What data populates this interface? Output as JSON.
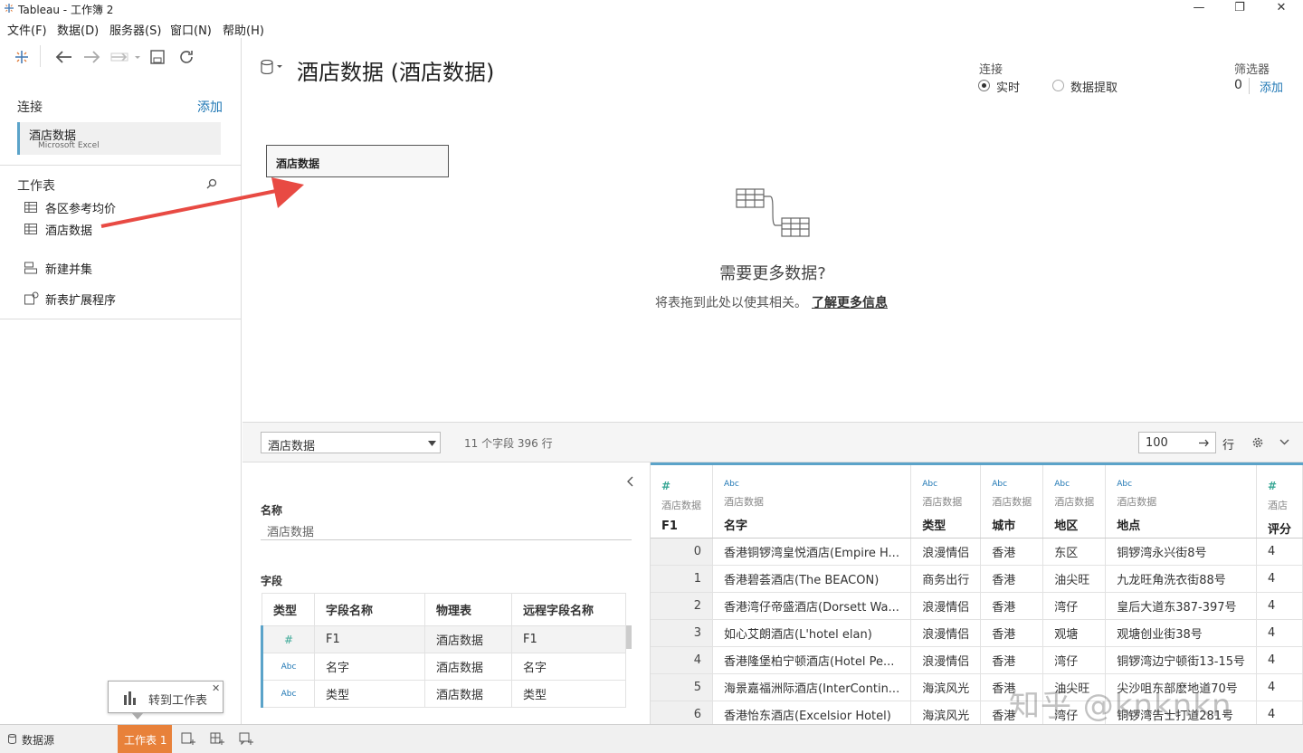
{
  "window": {
    "title": "Tableau - 工作簿 2",
    "minimize": "—",
    "maximize": "❐",
    "close": "✕"
  },
  "menu": [
    "文件(F)",
    "数据(D)",
    "服务器(S)",
    "窗口(N)",
    "帮助(H)"
  ],
  "left": {
    "connections_title": "连接",
    "add_label": "添加",
    "connection_name": "酒店数据",
    "connection_type": "Microsoft Excel",
    "sheets_title": "工作表",
    "sheets": [
      "各区参考均价",
      "酒店数据"
    ],
    "new_union": "新建并集",
    "new_extension": "新表扩展程序"
  },
  "canvas": {
    "datasource_title": "酒店数据 (酒店数据)",
    "connection_label": "连接",
    "live_label": "实时",
    "extract_label": "数据提取",
    "filters_label": "筛选器",
    "filters_count": "0",
    "filters_add": "添加",
    "table_pill": "酒店数据",
    "need_more": "需要更多数据?",
    "drag_hint": "将表拖到此处以使其相关。",
    "learn_more": "了解更多信息"
  },
  "gridbar": {
    "table_select": "酒店数据",
    "summary": "11 个字段 396 行",
    "rows_value": "100",
    "rows_label": "行"
  },
  "meta": {
    "name_label": "名称",
    "name_value": "酒店数据",
    "fields_label": "字段",
    "headers": [
      "类型",
      "字段名称",
      "物理表",
      "远程字段名称"
    ],
    "rows": [
      {
        "type": "#",
        "name": "F1",
        "table": "酒店数据",
        "remote": "F1"
      },
      {
        "type": "Abc",
        "name": "名字",
        "table": "酒店数据",
        "remote": "名字"
      },
      {
        "type": "Abc",
        "name": "类型",
        "table": "酒店数据",
        "remote": "类型"
      }
    ]
  },
  "grid": {
    "columns": [
      {
        "type": "#",
        "source": "酒店数据",
        "name": "F1"
      },
      {
        "type": "Abc",
        "source": "酒店数据",
        "name": "名字"
      },
      {
        "type": "Abc",
        "source": "酒店数据",
        "name": "类型"
      },
      {
        "type": "Abc",
        "source": "酒店数据",
        "name": "城市"
      },
      {
        "type": "Abc",
        "source": "酒店数据",
        "name": "地区"
      },
      {
        "type": "Abc",
        "source": "酒店数据",
        "name": "地点"
      },
      {
        "type": "#",
        "source": "酒店",
        "name": "评分"
      }
    ],
    "rows": [
      [
        "0",
        "香港铜锣湾皇悦酒店(Empire H...",
        "浪漫情侣",
        "香港",
        "东区",
        "铜锣湾永兴街8号",
        "4"
      ],
      [
        "1",
        "香港碧荟酒店(The BEACON)",
        "商务出行",
        "香港",
        "油尖旺",
        "九龙旺角洗衣街88号",
        "4"
      ],
      [
        "2",
        "香港湾仔帝盛酒店(Dorsett Wa...",
        "浪漫情侣",
        "香港",
        "湾仔",
        "皇后大道东387-397号",
        "4"
      ],
      [
        "3",
        "如心艾朗酒店(L'hotel elan)",
        "浪漫情侣",
        "香港",
        "观塘",
        "观塘创业街38号",
        "4"
      ],
      [
        "4",
        "香港隆堡柏宁顿酒店(Hotel Pe...",
        "浪漫情侣",
        "香港",
        "湾仔",
        "铜锣湾边宁顿街13-15号",
        "4"
      ],
      [
        "5",
        "海景嘉福洲际酒店(InterContin...",
        "海滨风光",
        "香港",
        "油尖旺",
        "尖沙咀东部麽地道70号",
        "4"
      ],
      [
        "6",
        "香港怡东酒店(Excelsior Hotel)",
        "海滨风光",
        "香港",
        "湾仔",
        "铜锣湾告士打道281号",
        "4"
      ]
    ]
  },
  "tooltip": {
    "goto_sheet": "转到工作表"
  },
  "status": {
    "datasource_tab": "数据源",
    "sheet_tab": "工作表 1"
  },
  "watermark": "知乎 @knknkn"
}
